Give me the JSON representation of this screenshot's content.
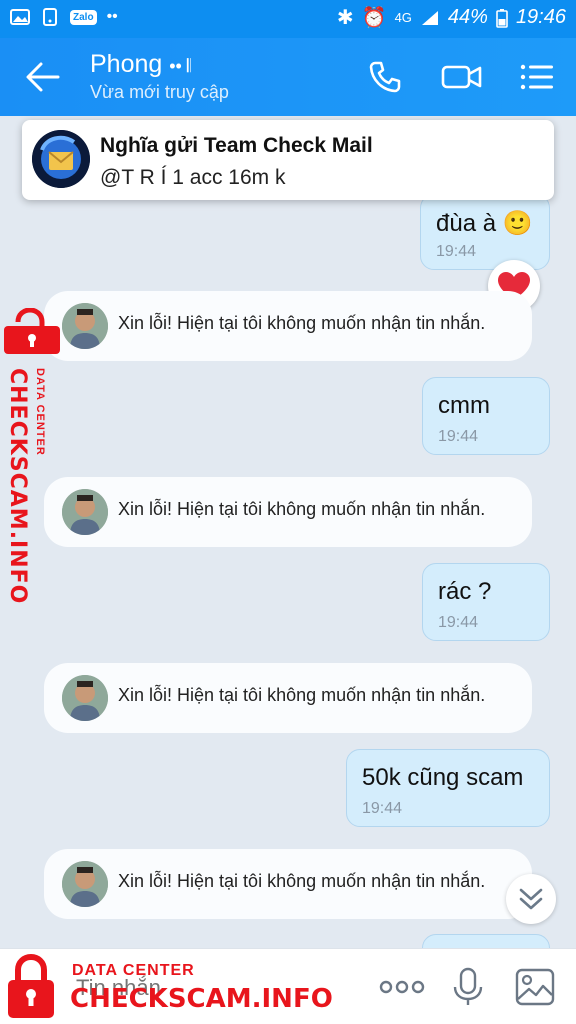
{
  "status_bar": {
    "network": "4G",
    "battery": "44%",
    "time": "19:46",
    "zalo_label": "Zalo"
  },
  "header": {
    "name": "Phong",
    "name_suffix": "•• 𝄃",
    "status": "Vừa mới truy cập"
  },
  "notification": {
    "sender": "Nghĩa gửi Team Check Mail",
    "body": "@T R Í 1 acc 16m k"
  },
  "messages_out": [
    {
      "text": "đùa à 🙂",
      "time": "19:44"
    },
    {
      "text": "cmm",
      "time": "19:44"
    },
    {
      "text": "rác ?",
      "time": "19:44"
    },
    {
      "text": "50k cũng scam",
      "time": "19:44"
    }
  ],
  "system_messages": [
    "Xin lỗi! Hiện tại tôi không muốn nhận tin nhắn.",
    "Xin lỗi! Hiện tại tôi không muốn nhận tin nhắn.",
    "Xin lỗi! Hiện tại tôi không muốn nhận tin nhắn.",
    "Xin lỗi! Hiện tại tôi không muốn nhận tin nhắn."
  ],
  "reaction": "❤️",
  "input": {
    "placeholder": "Tin nhắn"
  },
  "watermark": {
    "small": "DATA CENTER",
    "big": "CHECKSCAM.INFO"
  },
  "colors": {
    "header": "#1a8ff5",
    "bubble_out": "#d4edfc",
    "watermark": "#e8151c"
  }
}
